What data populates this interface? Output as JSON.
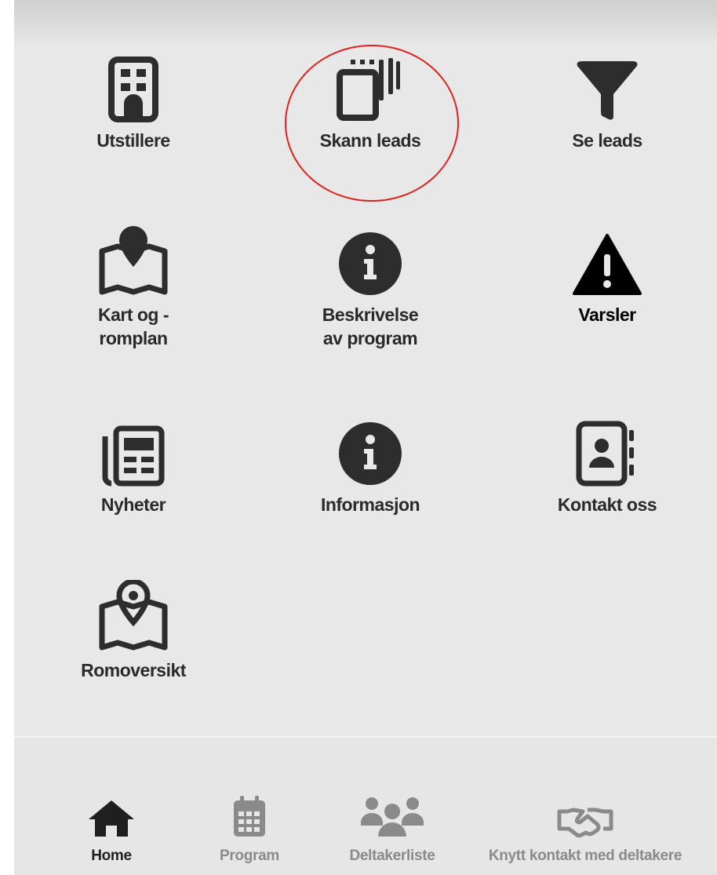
{
  "tiles": {
    "exhibitors": "Utstillere",
    "scan_leads": "Skann leads",
    "see_leads": "Se leads",
    "map_line1": "Kart og -",
    "map_line2": "romplan",
    "description_line1": "Beskrivelse",
    "description_line2": "av program",
    "alerts": "Varsler",
    "news": "Nyheter",
    "information": "Informasjon",
    "contact": "Kontakt oss",
    "room_overview": "Romoversikt"
  },
  "nav": {
    "home": "Home",
    "program": "Program",
    "participants": "Deltakerliste",
    "connect": "Knytt kontakt med deltakere"
  },
  "colors": {
    "icon": "#2d2d2d",
    "background": "#e8e8e8",
    "highlight_circle": "#e0221f",
    "nav_inactive": "#8a8a8a"
  }
}
